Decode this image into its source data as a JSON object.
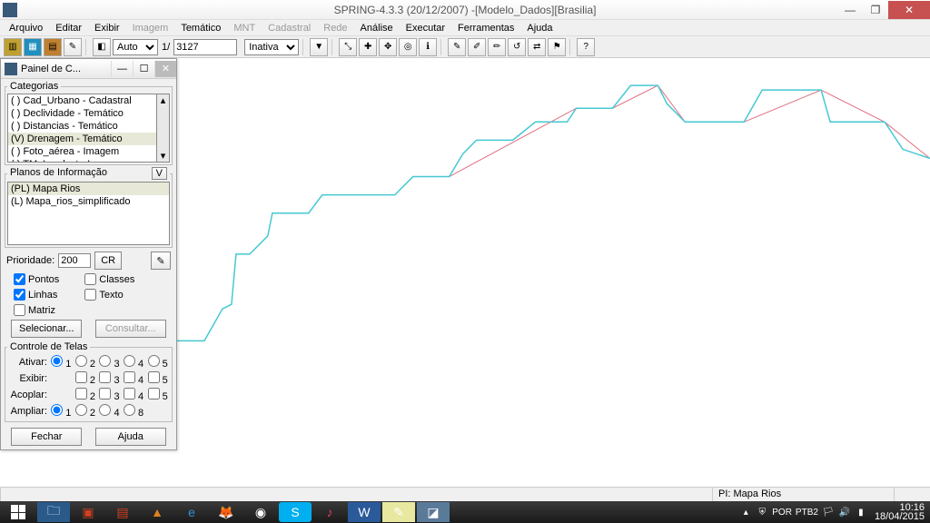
{
  "window": {
    "title": "SPRING-4.3.3 (20/12/2007) -[Modelo_Dados][Brasilia]"
  },
  "menu": {
    "items": [
      "Arquivo",
      "Editar",
      "Exibir",
      "Imagem",
      "Temático",
      "MNT",
      "Cadastral",
      "Rede",
      "Análise",
      "Executar",
      "Ferramentas",
      "Ajuda"
    ],
    "disabled": [
      "Imagem",
      "MNT",
      "Cadastral",
      "Rede"
    ]
  },
  "toolbar": {
    "scale_mode": "Auto",
    "scale_prefix": "1/",
    "scale_value": "3127",
    "status": "Inativa"
  },
  "panel": {
    "title": "Painel de C...",
    "categorias_label": "Categorias",
    "categorias": [
      "( ) Cad_Urbano - Cadastral",
      "( ) Declividade - Temático",
      "( ) Distancias - Temático",
      "(V) Drenagem - Temático",
      "( ) Foto_aérea - Imagem",
      "( ) TM_Landsat - Imagem"
    ],
    "categorias_selected": 3,
    "planos_label": "Planos de Informação",
    "planos_v": "V",
    "planos": [
      "(PL) Mapa Rios",
      "(L) Mapa_rios_simplificado"
    ],
    "planos_selected": 0,
    "prioridade_label": "Prioridade:",
    "prioridade_value": "200",
    "cr_label": "CR",
    "chk_pontos": "Pontos",
    "chk_classes": "Classes",
    "chk_linhas": "Linhas",
    "chk_texto": "Texto",
    "chk_matriz": "Matriz",
    "btn_selecionar": "Selecionar...",
    "btn_consultar": "Consultar...",
    "controle_label": "Controle de Telas",
    "row_ativar": "Ativar:",
    "row_exibir": "Exibir:",
    "row_acoplar": "Acoplar:",
    "row_ampliar": "Ampliar:",
    "cols": [
      "1",
      "2",
      "3",
      "4",
      "5"
    ],
    "ampliar_cols": [
      "1",
      "2",
      "4",
      "8"
    ],
    "btn_fechar": "Fechar",
    "btn_ajuda": "Ajuda"
  },
  "chart_data": {
    "type": "line",
    "title": "",
    "xlabel": "",
    "ylabel": "",
    "x_range": [
      0,
      830
    ],
    "y_range": [
      0,
      470
    ],
    "series": [
      {
        "name": "Mapa Rios",
        "color": "#46c8d4",
        "points": [
          [
            0,
            310
          ],
          [
            30,
            310
          ],
          [
            50,
            275
          ],
          [
            60,
            270
          ],
          [
            65,
            215
          ],
          [
            80,
            215
          ],
          [
            100,
            195
          ],
          [
            105,
            170
          ],
          [
            145,
            170
          ],
          [
            160,
            150
          ],
          [
            240,
            150
          ],
          [
            260,
            130
          ],
          [
            300,
            130
          ],
          [
            315,
            105
          ],
          [
            330,
            90
          ],
          [
            370,
            90
          ],
          [
            395,
            70
          ],
          [
            430,
            70
          ],
          [
            440,
            55
          ],
          [
            480,
            55
          ],
          [
            500,
            30
          ],
          [
            530,
            30
          ],
          [
            540,
            50
          ],
          [
            560,
            70
          ],
          [
            625,
            70
          ],
          [
            645,
            35
          ],
          [
            710,
            35
          ],
          [
            720,
            70
          ],
          [
            780,
            70
          ],
          [
            800,
            100
          ],
          [
            830,
            110
          ]
        ]
      },
      {
        "name": "Mapa_rios_simplificado",
        "color": "#e07080",
        "points": [
          [
            300,
            130
          ],
          [
            440,
            55
          ],
          [
            480,
            55
          ],
          [
            530,
            30
          ],
          [
            560,
            70
          ],
          [
            625,
            70
          ],
          [
            710,
            35
          ],
          [
            780,
            70
          ],
          [
            830,
            110
          ]
        ]
      }
    ]
  },
  "statusbar": {
    "pi_label": "PI: Mapa Rios"
  },
  "tray": {
    "lang": "POR",
    "kbd": "PTB2",
    "time": "10:16",
    "date": "18/04/2015"
  }
}
